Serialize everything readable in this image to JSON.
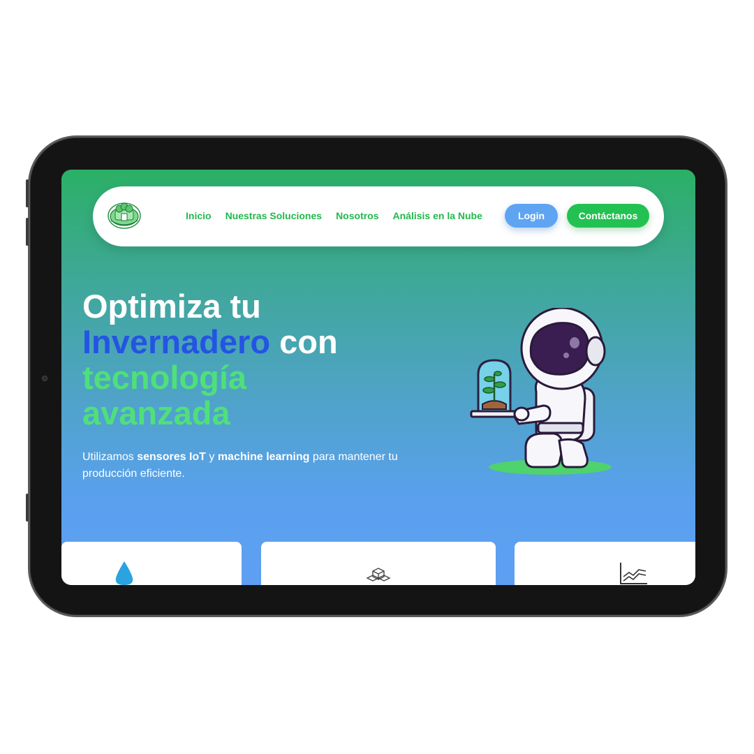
{
  "nav": {
    "links": [
      "Inicio",
      "Nuestras Soluciones",
      "Nosotros",
      "Análisis en la Nube"
    ],
    "login_label": "Login",
    "contact_label": "Contáctanos"
  },
  "hero": {
    "title_line1": "Optimiza tu",
    "title_highlight": "Invernadero",
    "title_con": "con",
    "title_line3": "tecnología",
    "title_line4": "avanzada",
    "sub_1": "Utilizamos ",
    "sub_bold_1": "sensores IoT",
    "sub_2": " y ",
    "sub_bold_2": "machine learning",
    "sub_3": " para mantener tu producción eficiente."
  },
  "colors": {
    "accent_green": "#22c152",
    "accent_blue": "#2454e3",
    "login_blue": "#5ea4f2"
  },
  "icons": [
    "logo-icon",
    "water-drop-icon",
    "cubes-icon",
    "chart-icon",
    "astronaut-illustration"
  ]
}
